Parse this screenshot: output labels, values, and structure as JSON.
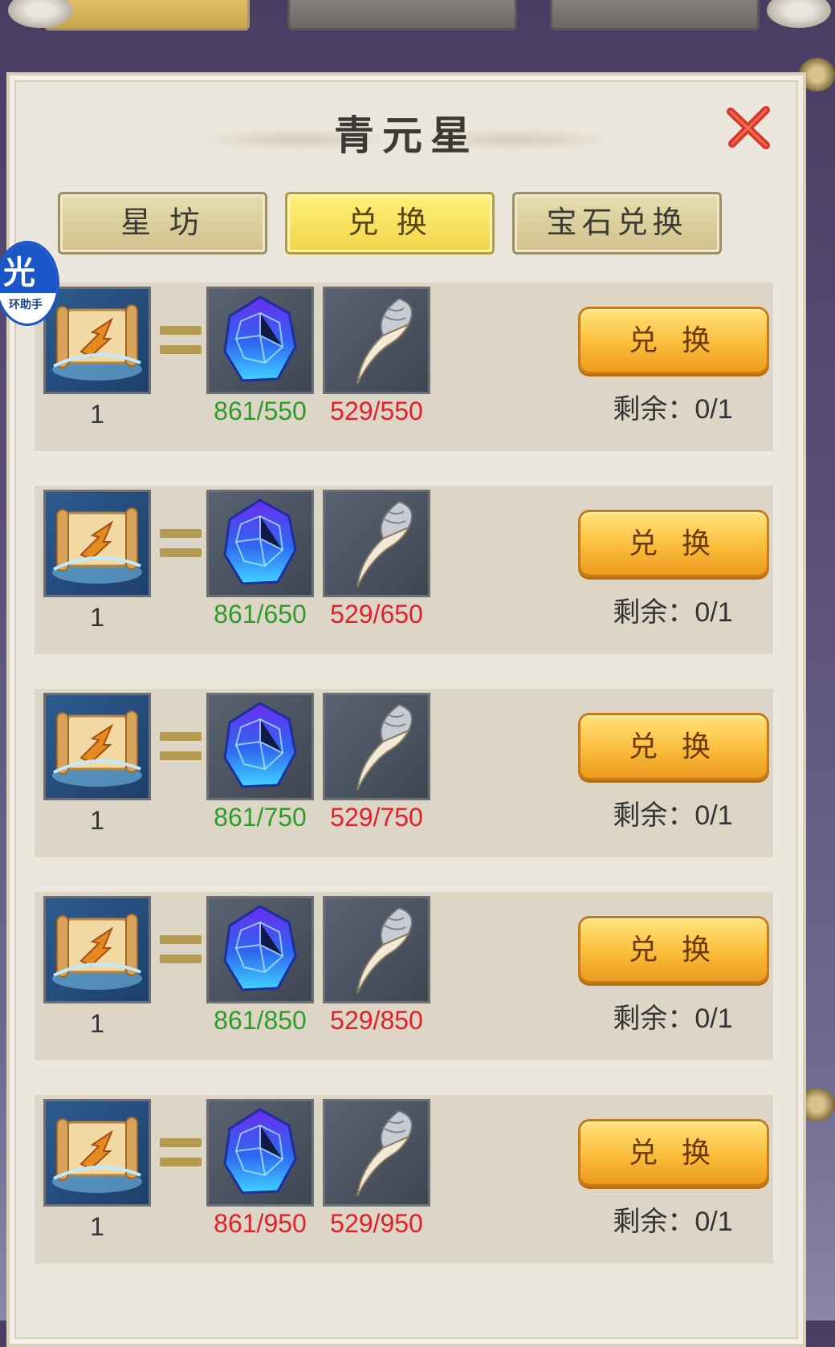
{
  "window": {
    "title": "青元星",
    "close_label": "close"
  },
  "tabs": [
    {
      "label": "星 坊",
      "active": false
    },
    {
      "label": "兑 换",
      "active": true
    },
    {
      "label": "宝石兑换",
      "active": false
    }
  ],
  "assistant": {
    "glyph": "光",
    "label": "环助手"
  },
  "rows": [
    {
      "qty": "1",
      "gem": "861/550",
      "gem_ok": true,
      "tooth": "529/550",
      "tooth_ok": false,
      "button": "兑 换",
      "remain": "剩余：0/1"
    },
    {
      "qty": "1",
      "gem": "861/650",
      "gem_ok": true,
      "tooth": "529/650",
      "tooth_ok": false,
      "button": "兑 换",
      "remain": "剩余：0/1"
    },
    {
      "qty": "1",
      "gem": "861/750",
      "gem_ok": true,
      "tooth": "529/750",
      "tooth_ok": false,
      "button": "兑 换",
      "remain": "剩余：0/1"
    },
    {
      "qty": "1",
      "gem": "861/850",
      "gem_ok": true,
      "tooth": "529/850",
      "tooth_ok": false,
      "button": "兑 换",
      "remain": "剩余：0/1"
    },
    {
      "qty": "1",
      "gem": "861/950",
      "gem_ok": false,
      "tooth": "529/950",
      "tooth_ok": false,
      "button": "兑 换",
      "remain": "剩余：0/1"
    }
  ],
  "colors": {
    "ok": "#2f9a2a",
    "insufficient": "#e2202a",
    "button": "#fbbd3c"
  },
  "icons": {
    "reward": "scroll-icon",
    "cost_1": "blue-gem-icon",
    "cost_2": "tooth-icon"
  }
}
